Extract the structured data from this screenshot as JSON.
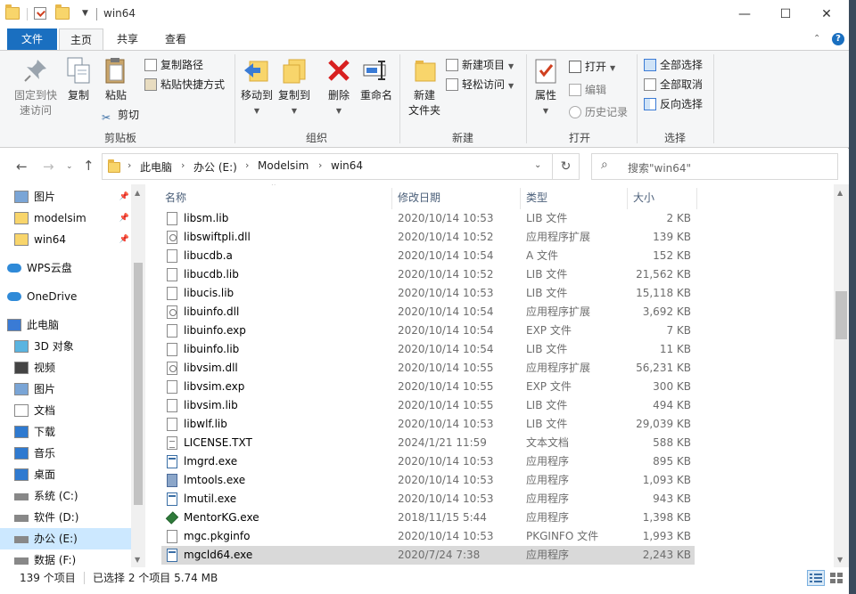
{
  "window": {
    "title": "win64",
    "minimize_glyph": "—",
    "maximize_glyph": "☐",
    "close_glyph": "✕"
  },
  "tabs": {
    "file": "文件",
    "home": "主页",
    "share": "共享",
    "view": "查看"
  },
  "ribbon": {
    "clipboard": {
      "label": "剪贴板",
      "pin": "固定到快速访问",
      "pin_l1": "固定到快",
      "pin_l2": "速访问",
      "copy": "复制",
      "paste": "粘贴",
      "copy_path": "复制路径",
      "paste_shortcut": "粘贴快捷方式",
      "cut": "剪切"
    },
    "organize": {
      "label": "组织",
      "move_to": "移动到",
      "copy_to": "复制到",
      "delete": "删除",
      "rename": "重命名"
    },
    "new": {
      "label": "新建",
      "new_folder_l1": "新建",
      "new_folder_l2": "文件夹",
      "new_item": "新建项目",
      "easy_access": "轻松访问"
    },
    "open": {
      "label": "打开",
      "properties": "属性",
      "open": "打开",
      "edit": "编辑",
      "history": "历史记录"
    },
    "select": {
      "label": "选择",
      "select_all": "全部选择",
      "select_none": "全部取消",
      "invert": "反向选择"
    }
  },
  "address": {
    "crumbs": [
      "此电脑",
      "办公 (E:)",
      "Modelsim",
      "win64"
    ],
    "search_placeholder": "搜索\"win64\""
  },
  "nav": {
    "items": [
      {
        "label": "图片",
        "icon": "pictures-icon"
      },
      {
        "label": "modelsim",
        "icon": "folder-icon"
      },
      {
        "label": "win64",
        "icon": "folder-icon"
      },
      {
        "label": "WPS云盘",
        "icon": "cloud-icon"
      },
      {
        "label": "OneDrive",
        "icon": "cloud-icon"
      },
      {
        "label": "此电脑",
        "icon": "computer-icon"
      },
      {
        "label": "3D 对象",
        "icon": "cube-icon"
      },
      {
        "label": "视频",
        "icon": "video-icon"
      },
      {
        "label": "图片",
        "icon": "pictures-icon"
      },
      {
        "label": "文档",
        "icon": "document-icon"
      },
      {
        "label": "下载",
        "icon": "download-icon"
      },
      {
        "label": "音乐",
        "icon": "music-icon"
      },
      {
        "label": "桌面",
        "icon": "desktop-icon"
      },
      {
        "label": "系统 (C:)",
        "icon": "drive-icon"
      },
      {
        "label": "软件 (D:)",
        "icon": "drive-icon"
      },
      {
        "label": "办公 (E:)",
        "icon": "drive-icon"
      },
      {
        "label": "数据 (F:)",
        "icon": "drive-icon"
      }
    ]
  },
  "columns": {
    "name": "名称",
    "date": "修改日期",
    "type": "类型",
    "size": "大小"
  },
  "files": [
    {
      "name": "libsm.lib",
      "date": "2020/10/14 10:53",
      "type": "LIB 文件",
      "size": "2 KB",
      "icon": "lib"
    },
    {
      "name": "libswiftpli.dll",
      "date": "2020/10/14 10:52",
      "type": "应用程序扩展",
      "size": "139 KB",
      "icon": "dll"
    },
    {
      "name": "libucdb.a",
      "date": "2020/10/14 10:54",
      "type": "A 文件",
      "size": "152 KB",
      "icon": "lib"
    },
    {
      "name": "libucdb.lib",
      "date": "2020/10/14 10:52",
      "type": "LIB 文件",
      "size": "21,562 KB",
      "icon": "lib"
    },
    {
      "name": "libucis.lib",
      "date": "2020/10/14 10:53",
      "type": "LIB 文件",
      "size": "15,118 KB",
      "icon": "lib"
    },
    {
      "name": "libuinfo.dll",
      "date": "2020/10/14 10:54",
      "type": "应用程序扩展",
      "size": "3,692 KB",
      "icon": "dll"
    },
    {
      "name": "libuinfo.exp",
      "date": "2020/10/14 10:54",
      "type": "EXP 文件",
      "size": "7 KB",
      "icon": "lib"
    },
    {
      "name": "libuinfo.lib",
      "date": "2020/10/14 10:54",
      "type": "LIB 文件",
      "size": "11 KB",
      "icon": "lib"
    },
    {
      "name": "libvsim.dll",
      "date": "2020/10/14 10:55",
      "type": "应用程序扩展",
      "size": "56,231 KB",
      "icon": "dll"
    },
    {
      "name": "libvsim.exp",
      "date": "2020/10/14 10:55",
      "type": "EXP 文件",
      "size": "300 KB",
      "icon": "lib"
    },
    {
      "name": "libvsim.lib",
      "date": "2020/10/14 10:55",
      "type": "LIB 文件",
      "size": "494 KB",
      "icon": "lib"
    },
    {
      "name": "libwlf.lib",
      "date": "2020/10/14 10:53",
      "type": "LIB 文件",
      "size": "29,039 KB",
      "icon": "lib"
    },
    {
      "name": "LICENSE.TXT",
      "date": "2024/1/21 11:59",
      "type": "文本文档",
      "size": "588 KB",
      "icon": "txt"
    },
    {
      "name": "lmgrd.exe",
      "date": "2020/10/14 10:53",
      "type": "应用程序",
      "size": "895 KB",
      "icon": "exe"
    },
    {
      "name": "lmtools.exe",
      "date": "2020/10/14 10:53",
      "type": "应用程序",
      "size": "1,093 KB",
      "icon": "tools"
    },
    {
      "name": "lmutil.exe",
      "date": "2020/10/14 10:53",
      "type": "应用程序",
      "size": "943 KB",
      "icon": "exe"
    },
    {
      "name": "MentorKG.exe",
      "date": "2018/11/15 5:44",
      "type": "应用程序",
      "size": "1,398 KB",
      "icon": "mentor"
    },
    {
      "name": "mgc.pkginfo",
      "date": "2020/10/14 10:53",
      "type": "PKGINFO 文件",
      "size": "1,993 KB",
      "icon": "lib"
    },
    {
      "name": "mgcld64.exe",
      "date": "2020/7/24 7:38",
      "type": "应用程序",
      "size": "2,243 KB",
      "icon": "exe"
    }
  ],
  "status": {
    "count": "139 个项目",
    "selected": "已选择 2 个项目  5.74 MB"
  },
  "colors": {
    "accent": "#1a6fc0",
    "selection": "#cce8ff",
    "row_selected": "#d9d9d9"
  }
}
